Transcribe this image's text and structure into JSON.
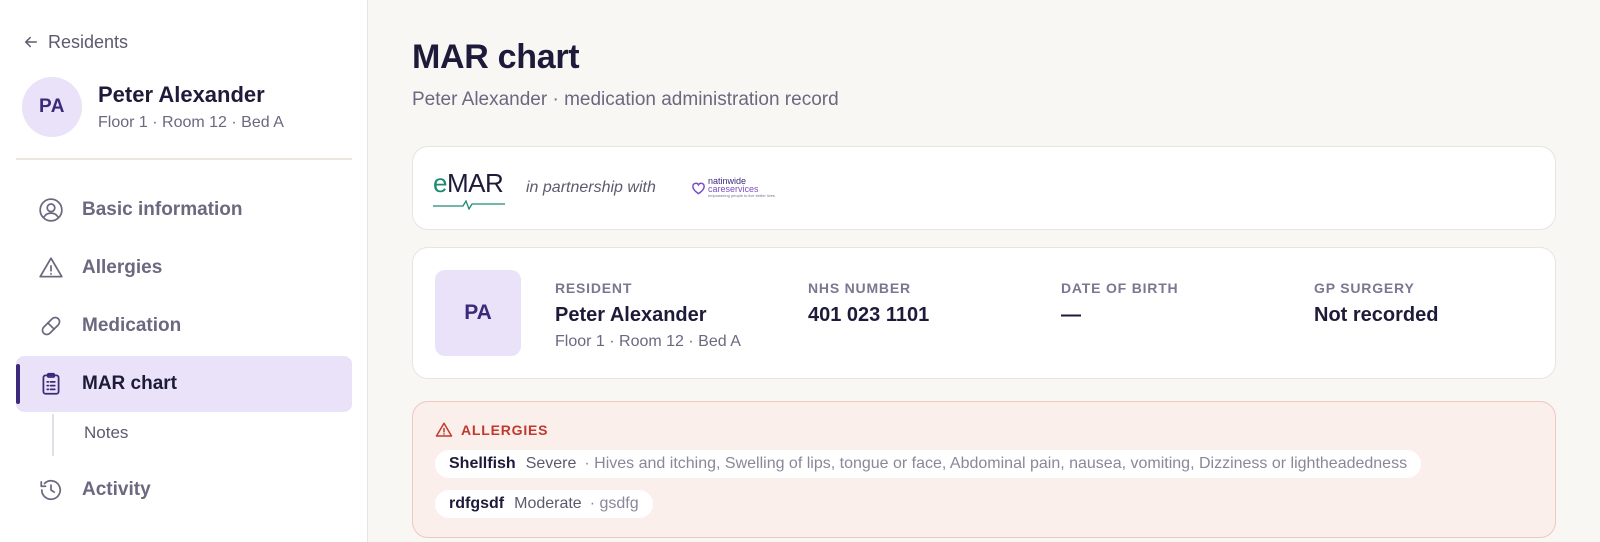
{
  "sidebar": {
    "back_label": "Residents",
    "profile": {
      "initials": "PA",
      "name": "Peter Alexander",
      "location": "Floor 1 · Room 12 · Bed A"
    },
    "nav": [
      {
        "label": "Basic information",
        "icon": "user-circle-icon"
      },
      {
        "label": "Allergies",
        "icon": "warning-triangle-icon"
      },
      {
        "label": "Medication",
        "icon": "pill-icon"
      },
      {
        "label": "MAR chart",
        "icon": "clipboard-icon",
        "active": true
      },
      {
        "label": "Activity",
        "icon": "history-icon"
      }
    ],
    "sub_item": "Notes"
  },
  "page": {
    "title": "MAR chart",
    "subtitle": "Peter Alexander · medication administration record"
  },
  "partner": {
    "emar_e": "e",
    "emar_rest": "MAR",
    "text": "in partnership with",
    "partner_line1": "nati",
    "partner_line1b": "nwide",
    "partner_line2": "careservices",
    "partner_line3": "empowering people to live better lives"
  },
  "resident": {
    "initials": "PA",
    "fields": {
      "resident": {
        "label": "RESIDENT",
        "value": "Peter Alexander",
        "sub": "Floor 1 · Room 12 · Bed A"
      },
      "nhs": {
        "label": "NHS NUMBER",
        "value": "401 023 1101"
      },
      "dob": {
        "label": "DATE OF BIRTH",
        "value": "—"
      },
      "gp": {
        "label": "GP SURGERY",
        "value": "Not recorded"
      }
    }
  },
  "allergies": {
    "heading": "ALLERGIES",
    "items": [
      {
        "name": "Shellfish",
        "severity": "Severe",
        "reaction": "· Hives and itching, Swelling of lips, tongue or face, Abdominal pain, nausea, vomiting, Dizziness or lightheadedness"
      },
      {
        "name": "rdfgsdf",
        "severity": "Moderate",
        "reaction": "· gsdfg"
      }
    ]
  },
  "colors": {
    "accent": "#3b2a7a",
    "active_bg": "#e9e2f8",
    "allergy_bg": "#fbefec",
    "allergy_red": "#c0392b",
    "emar_green": "#1f8a70"
  }
}
